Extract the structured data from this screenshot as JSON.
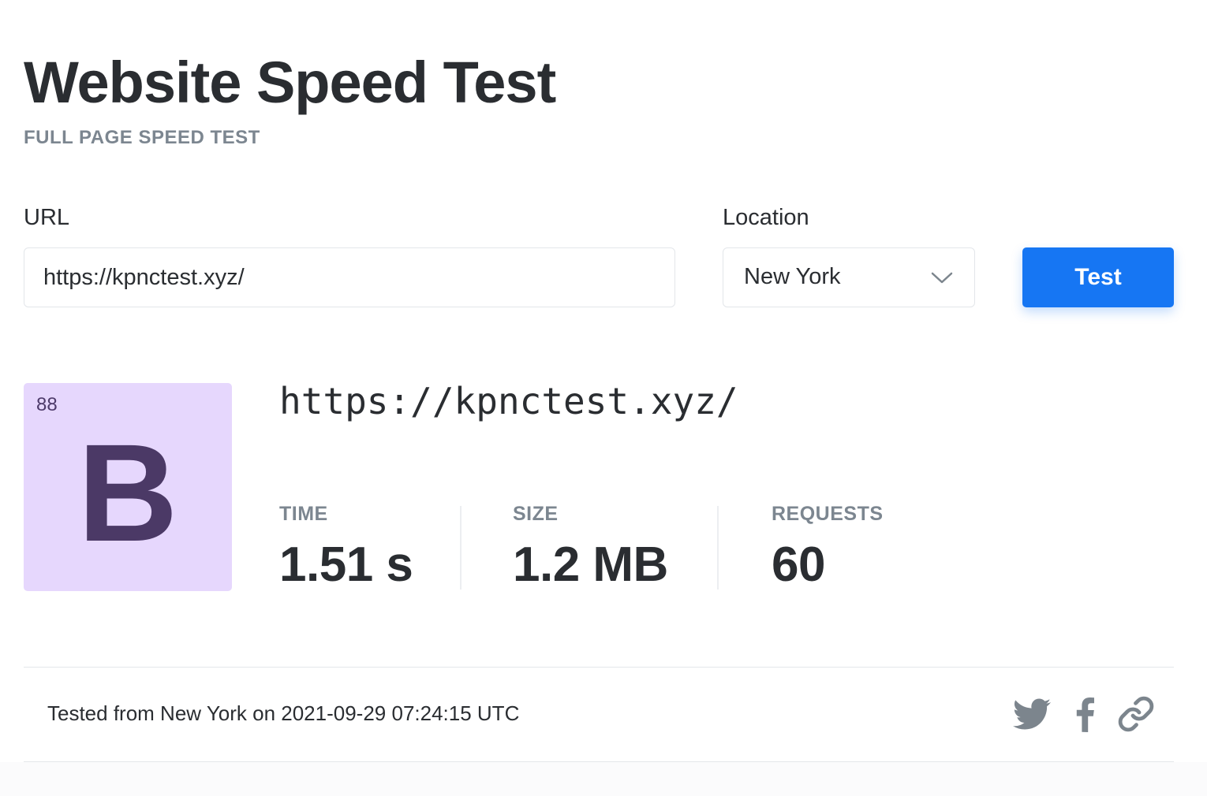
{
  "header": {
    "title": "Website Speed Test",
    "subtitle": "FULL PAGE SPEED TEST"
  },
  "form": {
    "url_label": "URL",
    "url_value": "https://kpnctest.xyz/",
    "location_label": "Location",
    "location_value": "New York",
    "test_button": "Test"
  },
  "result": {
    "score": "88",
    "grade": "B",
    "url": "https://kpnctest.xyz/",
    "metrics": [
      {
        "label": "TIME",
        "value": "1.51 s"
      },
      {
        "label": "SIZE",
        "value": "1.2 MB"
      },
      {
        "label": "REQUESTS",
        "value": "60"
      }
    ]
  },
  "footer": {
    "tested_text": "Tested from New York on 2021-09-29 07:24:15 UTC",
    "share_icons": [
      "twitter-icon",
      "facebook-icon",
      "link-icon"
    ]
  },
  "colors": {
    "accent": "#1676f3",
    "grade_bg": "#e6d7fd",
    "grade_fg": "#4b3966",
    "muted": "#7c8690",
    "text": "#2a2d31",
    "icon": "#7c858d"
  }
}
